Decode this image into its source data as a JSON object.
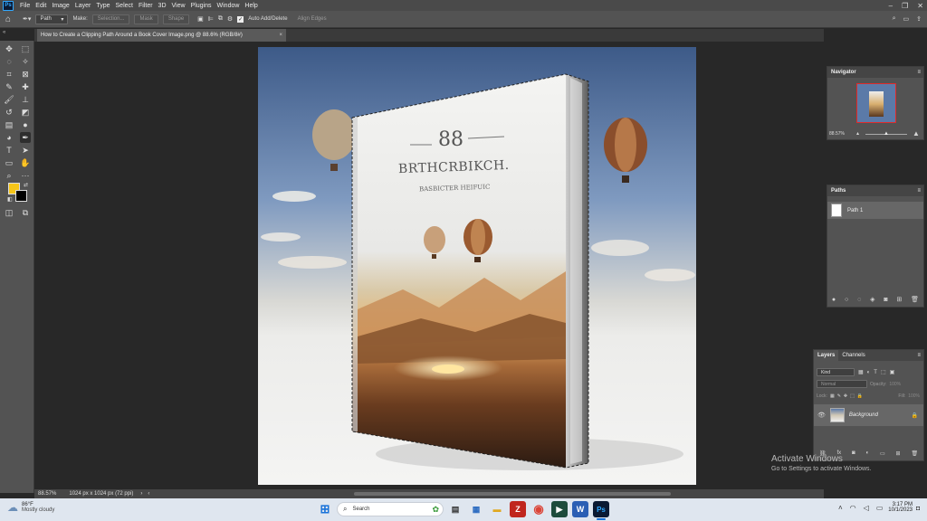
{
  "app": {
    "logo": "Ps"
  },
  "menu": [
    "File",
    "Edit",
    "Image",
    "Layer",
    "Type",
    "Select",
    "Filter",
    "3D",
    "View",
    "Plugins",
    "Window",
    "Help"
  ],
  "options": {
    "mode": "Path",
    "make_label": "Make:",
    "selection_btn": "Selection...",
    "mask_btn": "Mask",
    "shape_btn": "Shape",
    "auto_add_delete": "Auto Add/Delete",
    "align_edges": "Align Edges"
  },
  "document_tab": {
    "title": "How to Create a Clipping Path Around a Book Cover Image.png @ 88.6% (RGB/8#)",
    "close": "×"
  },
  "book": {
    "number": "88",
    "title": "BRTHCRBIKCH.",
    "subtitle": "BASBICTER HEIFUIC"
  },
  "navigator": {
    "title": "Navigator",
    "zoom": "88.57%"
  },
  "paths": {
    "title": "Paths",
    "items": [
      "Path 1"
    ]
  },
  "layers": {
    "tabs": [
      "Layers",
      "Channels"
    ],
    "kind_placeholder": "Kind",
    "blend_mode": "Normal",
    "opacity_label": "Opacity:",
    "opacity_value": "100%",
    "lock_label": "Lock:",
    "fill_label": "Fill:",
    "fill_value": "100%",
    "items": [
      "Background"
    ]
  },
  "status": {
    "zoom": "88.57%",
    "doc_info": "1024 px x 1024 px (72 ppi)"
  },
  "watermark": {
    "title": "Activate Windows",
    "subtitle": "Go to Settings to activate Windows."
  },
  "taskbar": {
    "weather_temp": "86°F",
    "weather_desc": "Mostly cloudy",
    "search_placeholder": "Search",
    "time": "3:17 PM",
    "date": "10/1/2023"
  },
  "colors": {
    "foreground": "#f5c518",
    "background": "#000000",
    "accent": "#31a8ff"
  }
}
